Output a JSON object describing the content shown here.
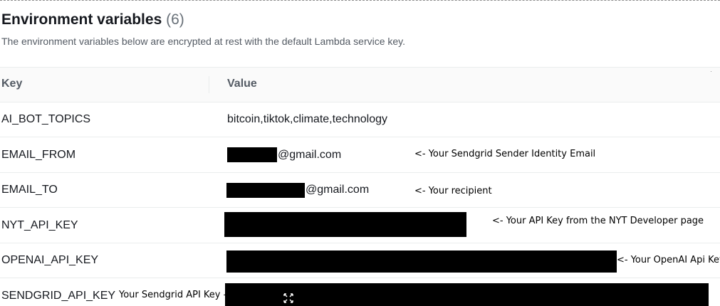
{
  "header": {
    "title": "Environment variables",
    "count": "(6)",
    "description": "The environment variables below are encrypted at rest with the default Lambda service key."
  },
  "table": {
    "columns": [
      "Key",
      "Value"
    ],
    "rows": [
      {
        "key": "AI_BOT_TOPICS",
        "value": "bitcoin,tiktok,climate,technology",
        "note": ""
      },
      {
        "key": "EMAIL_FROM",
        "value": "@gmail.com",
        "note": "<- Your Sendgrid Sender Identity Email"
      },
      {
        "key": "EMAIL_TO",
        "value": "@gmail.com",
        "note": "<- Your recipient"
      },
      {
        "key": "NYT_API_KEY",
        "value": "",
        "note": "<- Your API Key from the NYT Developer page"
      },
      {
        "key": "OPENAI_API_KEY",
        "value": "",
        "note": "<- Your OpenAI Api Key"
      },
      {
        "key": "SENDGRID_API_KEY",
        "value": "",
        "note": "Your Sendgrid API Key -"
      }
    ]
  },
  "icons": {
    "move": "move-arrows-icon"
  },
  "colors": {
    "text": "#16191f",
    "muted": "#545b64",
    "divider": "#eaeded",
    "redaction": "#000000"
  }
}
